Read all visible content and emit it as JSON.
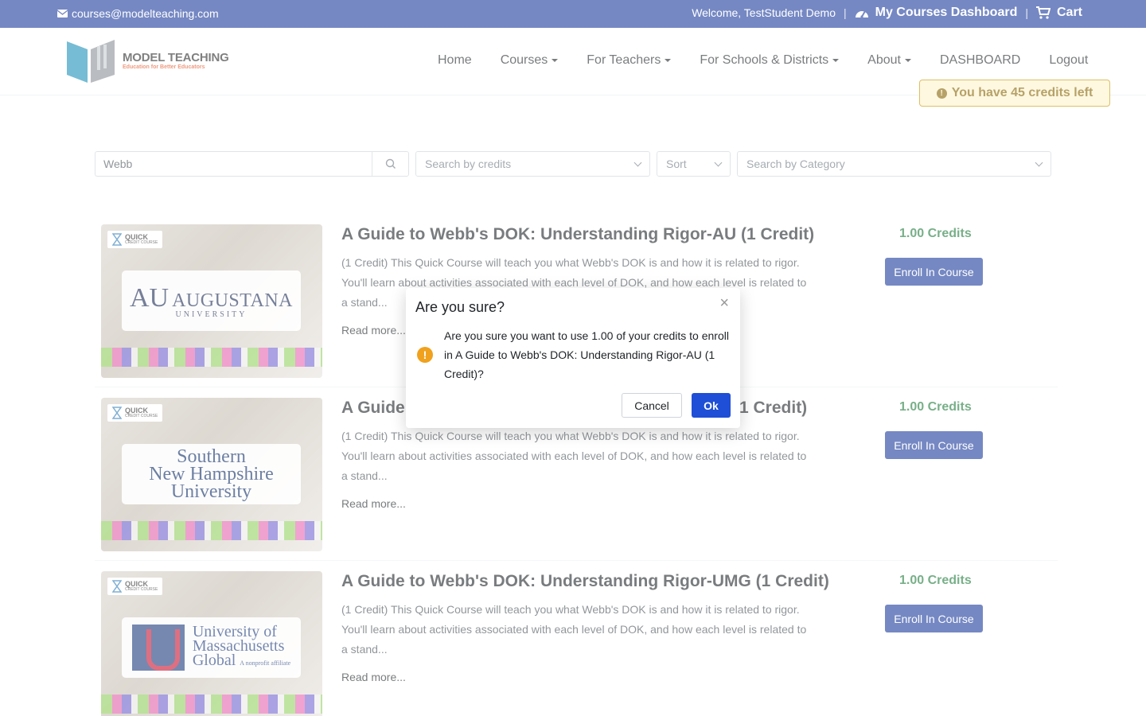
{
  "topbar": {
    "email": "courses@modelteaching.com",
    "welcome": "Welcome,  TestStudent Demo",
    "dashboard": "My Courses Dashboard",
    "cart": "Cart"
  },
  "logo": {
    "name": "MODEL TEACHING",
    "tagline": "Education for Better Educators"
  },
  "nav": {
    "home": "Home",
    "courses": "Courses",
    "for_teachers": "For Teachers",
    "for_schools": "For Schools & Districts",
    "about": "About",
    "dashboard": "DASHBOARD",
    "logout": "Logout"
  },
  "credits_alert": "You have 45 credits left",
  "filters": {
    "search_value": "Webb",
    "credits_placeholder": "Search by credits",
    "sort_placeholder": "Sort",
    "category_placeholder": "Search by Category"
  },
  "courses": [
    {
      "title": "A Guide to Webb's DOK: Understanding Rigor-AU (1 Credit)",
      "description": "(1 Credit) This Quick Course will teach you what Webb's DOK is and how it is related to rigor. You'll learn about activities associated with each level of DOK, and how each level is related to a stand...",
      "read_more": "Read more...",
      "credits": "1.00 Credits",
      "enroll": "Enroll In Course",
      "badge": "QUICK",
      "badge_sub": "CREDIT COURSE",
      "logo_mark": "AU",
      "logo_name": "AUGUSTANA",
      "logo_sub": "UNIVERSITY"
    },
    {
      "title_start": "A Guide t",
      "title_end": "1 Credit)",
      "description": "(1 Credit) This Quick Course will teach you what Webb's DOK is and how it is related to rigor. You'll learn about activities associated with each level of DOK, and how each level is related to a stand...",
      "read_more": "Read more...",
      "credits": "1.00 Credits",
      "enroll": "Enroll In Course",
      "badge": "QUICK",
      "badge_sub": "CREDIT COURSE",
      "logo_line1": "Southern",
      "logo_line2": "New Hampshire",
      "logo_line3": "University"
    },
    {
      "title": "A Guide to Webb's DOK: Understanding Rigor-UMG (1 Credit)",
      "description": "(1 Credit) This Quick Course will teach you what Webb's DOK is and how it is related to rigor. You'll learn about activities associated with each level of DOK, and how each level is related to a stand...",
      "read_more": "Read more...",
      "credits": "1.00 Credits",
      "enroll": "Enroll In Course",
      "badge": "QUICK",
      "badge_sub": "CREDIT COURSE",
      "logo_line1": "University of",
      "logo_line2": "Massachusetts",
      "logo_line3": "Global",
      "logo_note": "A nonprofit affiliate"
    }
  ],
  "modal": {
    "title": "Are you sure?",
    "close": "×",
    "icon": "!",
    "body": "Are you sure you want to use 1.00 of your credits to enroll in A Guide to Webb's DOK: Understanding Rigor-AU (1 Credit)?",
    "cancel": "Cancel",
    "ok": "Ok"
  },
  "colors": {
    "brand": "#1a3a9c",
    "credits_green": "#1d7a3a",
    "ok_button": "#1f4fd6",
    "warning": "#f0a11d"
  }
}
